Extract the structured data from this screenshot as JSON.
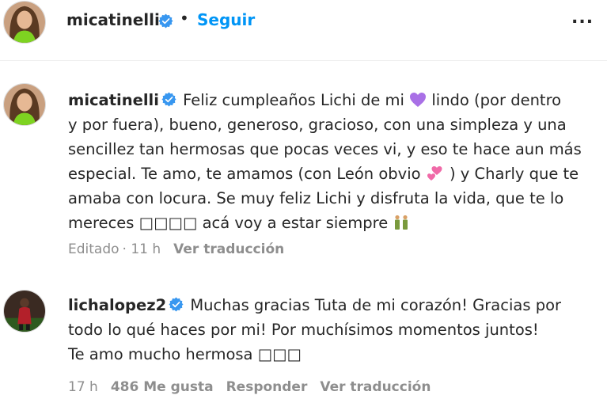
{
  "header": {
    "username": "micatinelli",
    "dot": "•",
    "follow_label": "Seguir",
    "more_label": "..."
  },
  "comments": [
    {
      "username": "micatinelli",
      "lines": [
        [
          "Feliz cumpleaños Lichi de mi",
          "lindo (por dentro"
        ],
        [
          "y por fuera), bueno, generoso, gracioso, con una simpleza y una"
        ],
        [
          "sencillez tan hermosas que pocas veces vi, y eso te hace aun más"
        ],
        [
          "especial. Te amo, te amamos (con León obvio",
          ") y Charly que te"
        ],
        [
          "amaba con locura. Se muy feliz Lichi y disfruta la vida, que te lo"
        ],
        [
          "mereces",
          "acá voy a estar siempre"
        ]
      ],
      "glyphs": "□□□□",
      "edited": "Editado",
      "time": "· 11 h",
      "translate": "Ver traducción"
    },
    {
      "username": "lichalopez2",
      "lines": [
        [
          "Muchas gracias Tuta de mi corazón! Gracias por"
        ],
        [
          "todo lo qué haces por mi! Por muchísimos momentos juntos!"
        ],
        [
          "Te amo mucho hermosa"
        ]
      ],
      "glyphs": "□□□",
      "time": "17 h",
      "likes": "486 Me gusta",
      "reply": "Responder",
      "translate": "Ver traducción"
    }
  ],
  "icons": {
    "verified": "verified-badge-icon",
    "heart": "purple-heart-icon",
    "hearts": "two-hearts-icon",
    "couple": "couple-icon"
  },
  "colors": {
    "link_blue": "#0095f6",
    "verified_blue": "#3897f0",
    "secondary_gray": "#8e8e8e",
    "text": "#262626",
    "heart_purple": "#a970e6",
    "hearts_pink": "#f06aa8"
  }
}
